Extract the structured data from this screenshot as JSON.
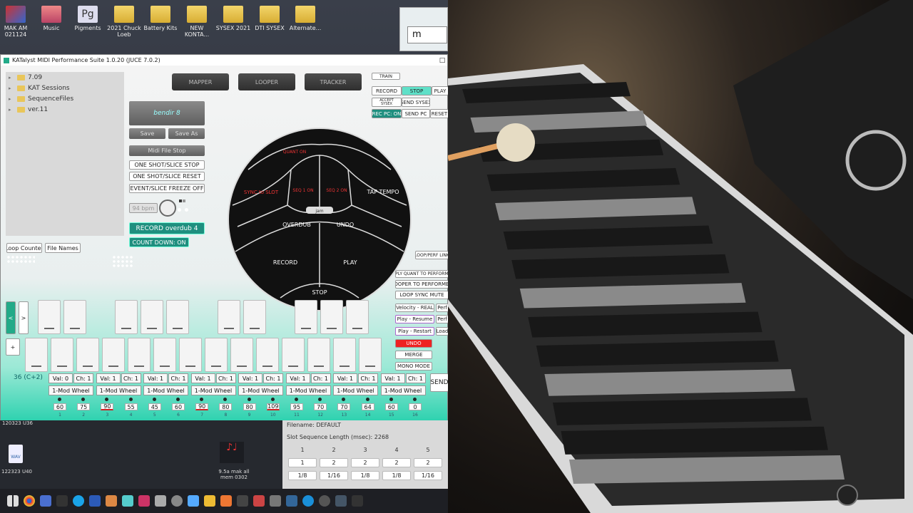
{
  "desktop": {
    "icons": [
      {
        "label": "MAK AM\n021124",
        "type": "app"
      },
      {
        "label": "Music",
        "type": "folder-music"
      },
      {
        "label": "Pigments",
        "type": "app-pg"
      },
      {
        "label": "2021 Chuck\nLoeb",
        "type": "folder"
      },
      {
        "label": "Battery Kits",
        "type": "folder"
      },
      {
        "label": "NEW\nKONTA...",
        "type": "folder"
      },
      {
        "label": "SYSEX 2021",
        "type": "folder"
      },
      {
        "label": "DTI SYSEX",
        "type": "folder"
      },
      {
        "label": "Alternate...",
        "type": "folder"
      }
    ],
    "search_text": "m",
    "bottom_icons": [
      {
        "label_top": "120323 U36",
        "label": "122323 U40",
        "type": "wav-icon"
      },
      {
        "label": "9.5a mak all\nmem 0302",
        "type": "midi-icon"
      }
    ]
  },
  "app": {
    "title": "KATalyst MIDI Performance Suite 1.0.20 (JUCE 7.0.2)",
    "tree": [
      "7.09",
      "KAT Sessions",
      "SequenceFiles",
      "ver.11"
    ],
    "tabs": [
      "MAPPER",
      "LOOPER",
      "TRACKER"
    ],
    "preset_name": "bendir 8",
    "save": "Save",
    "save_as": "Save As",
    "midi_file_stop": "Midi File Stop",
    "one_shot_stop": "ONE SHOT/SLICE STOP",
    "one_shot_reset": "ONE SHOT/SLICE RESET",
    "event_freeze": "EVENT/SLICE FREEZE OFF",
    "bpm": "94 bpm",
    "record_overdub": "RECORD overdub 4",
    "count_down": "COUNT DOWN: ON",
    "loop_counter": "Loop Counter",
    "file_names": "File Names",
    "right_top": {
      "train": "TRAIN",
      "record": "RECORD",
      "stop": "STOP",
      "play": "PLAY",
      "accept_sysex": "ACCEPT\nSYSEX",
      "send_sysex": "SEND SYSEX",
      "rec_pc": "REC PC: ON",
      "send_pc": "SEND PC",
      "reset": "RESET"
    },
    "pad": {
      "quant": "QUANT ON",
      "sync": "SYNC to SLOT",
      "seq1": "SEQ 1 ON",
      "seq2": "SEQ 2 ON",
      "tap": "TAP TEMPO",
      "jam": "jam",
      "overdub": "OVERDUB",
      "undo": "UNDO",
      "record": "RECORD",
      "play": "PLAY",
      "stop": "STOP"
    },
    "right_mid": {
      "loop_perf_link": "LOOP/PERF LINK",
      "apply_quant": "APPLY QUANT TO PERFORMER",
      "looper_to_perf": "LOOPER TO PERFORMER",
      "loop_sync_mute": "LOOP SYNC MUTE",
      "velocity": "Velocity - REAL",
      "perf1": "Perf",
      "play_resume": "Play - Resume",
      "perf2": "Perf",
      "play_restart": "Play - Restart",
      "load": "Load",
      "undo": "UNDO",
      "merge": "MERGE",
      "mono": "MONO MODE"
    },
    "nav_prev": "<",
    "nav_next": ">",
    "add": "+",
    "note_label": "36 (C+2)",
    "send": "SEND",
    "controls": [
      {
        "val": "Val: 0",
        "ch": "Ch: 1",
        "cc": "1-Mod Wheel"
      },
      {
        "val": "Val: 1",
        "ch": "Ch: 1",
        "cc": "1-Mod Wheel"
      },
      {
        "val": "Val: 1",
        "ch": "Ch: 1",
        "cc": "1-Mod Wheel"
      },
      {
        "val": "Val: 1",
        "ch": "Ch: 1",
        "cc": "1-Mod Wheel"
      },
      {
        "val": "Val: 1",
        "ch": "Ch: 1",
        "cc": "1-Mod Wheel"
      },
      {
        "val": "Val: 1",
        "ch": "Ch: 1",
        "cc": "1-Mod Wheel"
      },
      {
        "val": "Val: 1",
        "ch": "Ch: 1",
        "cc": "1-Mod Wheel"
      },
      {
        "val": "Val: 1",
        "ch": "Ch: 1",
        "cc": "1-Mod Wheel"
      }
    ],
    "slots": [
      "60",
      "75",
      "90",
      "55",
      "45",
      "60",
      "90",
      "80",
      "80",
      "109",
      "95",
      "70",
      "70",
      "64",
      "60",
      "0"
    ],
    "slot_index": [
      "1",
      "2",
      "3",
      "4",
      "5",
      "6",
      "7",
      "8",
      "9",
      "10",
      "11",
      "12",
      "13",
      "14",
      "15",
      "16"
    ],
    "seq": {
      "filename": "Filename: DEFAULT",
      "length": "Slot Sequence Length (msec): 2268",
      "cols": [
        "1",
        "2",
        "3",
        "4",
        "5"
      ],
      "row1": [
        "1",
        "2",
        "2",
        "2",
        "2"
      ],
      "row2": [
        "1/8",
        "1/16",
        "1/8",
        "1/8",
        "1/16"
      ]
    }
  }
}
